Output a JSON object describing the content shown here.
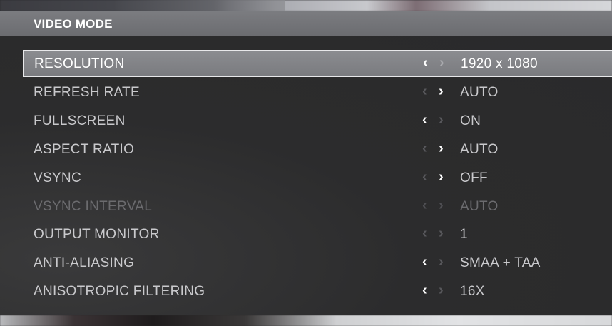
{
  "header": {
    "title": "VIDEO MODE"
  },
  "settings": [
    {
      "label": "RESOLUTION",
      "value": "1920 x 1080",
      "left_enabled": true,
      "right_enabled": false,
      "selected": true,
      "disabled": false
    },
    {
      "label": "REFRESH RATE",
      "value": "AUTO",
      "left_enabled": false,
      "right_enabled": true,
      "selected": false,
      "disabled": false
    },
    {
      "label": "FULLSCREEN",
      "value": "ON",
      "left_enabled": true,
      "right_enabled": false,
      "selected": false,
      "disabled": false
    },
    {
      "label": "ASPECT RATIO",
      "value": "AUTO",
      "left_enabled": false,
      "right_enabled": true,
      "selected": false,
      "disabled": false
    },
    {
      "label": "VSYNC",
      "value": "OFF",
      "left_enabled": false,
      "right_enabled": true,
      "selected": false,
      "disabled": false
    },
    {
      "label": "VSYNC INTERVAL",
      "value": "AUTO",
      "left_enabled": false,
      "right_enabled": false,
      "selected": false,
      "disabled": true
    },
    {
      "label": "OUTPUT MONITOR",
      "value": "1",
      "left_enabled": false,
      "right_enabled": false,
      "selected": false,
      "disabled": false
    },
    {
      "label": "ANTI-ALIASING",
      "value": "SMAA + TAA",
      "left_enabled": true,
      "right_enabled": false,
      "selected": false,
      "disabled": false
    },
    {
      "label": "ANISOTROPIC FILTERING",
      "value": "16X",
      "left_enabled": true,
      "right_enabled": false,
      "selected": false,
      "disabled": false
    }
  ],
  "icons": {
    "left_arrow": "chevron-left-icon",
    "right_arrow": "chevron-right-icon"
  },
  "colors": {
    "header_bg": "#6f7074",
    "selected_row_bg": "#848589",
    "text": "#c9c9cc",
    "disabled_text": "#6b6b6e"
  }
}
